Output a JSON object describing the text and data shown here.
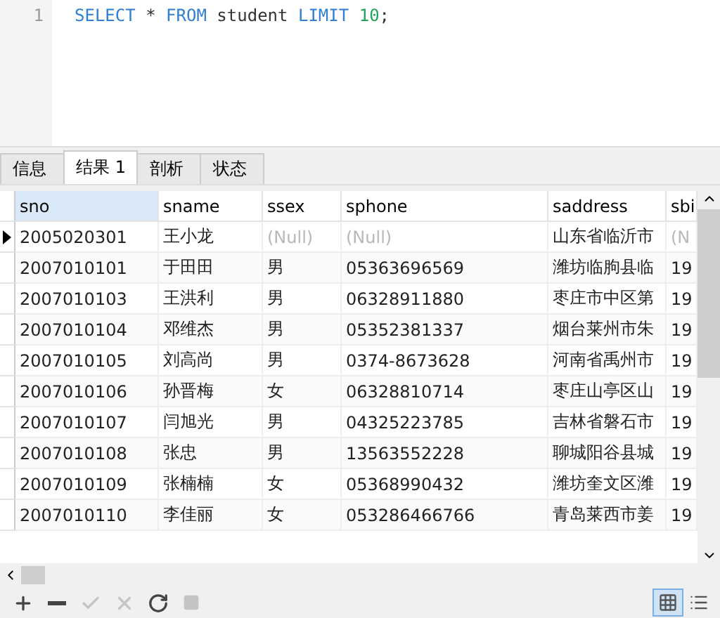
{
  "editor": {
    "lines": [
      {
        "number": "1",
        "tokens": [
          {
            "kind": "keyword",
            "text": "SELECT"
          },
          {
            "kind": "plain",
            "text": " * "
          },
          {
            "kind": "keyword",
            "text": "FROM"
          },
          {
            "kind": "plain",
            "text": " student "
          },
          {
            "kind": "keyword",
            "text": "LIMIT "
          },
          {
            "kind": "number",
            "text": "10"
          },
          {
            "kind": "plain",
            "text": ";"
          }
        ]
      }
    ]
  },
  "tabs": [
    {
      "label": "信息",
      "selected": false
    },
    {
      "label": "结果 1",
      "selected": true
    },
    {
      "label": "剖析",
      "selected": false
    },
    {
      "label": "状态",
      "selected": false
    }
  ],
  "table": {
    "columns": [
      "sno",
      "sname",
      "ssex",
      "sphone",
      "saddress",
      "sbi"
    ],
    "rows": [
      {
        "current": true,
        "cells": [
          "2005020301",
          "王小龙",
          {
            "text": "(Null)",
            "null": true
          },
          {
            "text": "(Null)",
            "null": true
          },
          "山东省临沂市",
          {
            "text": "(N",
            "null": true
          }
        ]
      },
      {
        "current": false,
        "cells": [
          "2007010101",
          "于田田",
          "男",
          "05363696569",
          "潍坊临朐县临",
          "19"
        ]
      },
      {
        "current": false,
        "cells": [
          "2007010103",
          "王洪利",
          "男",
          "06328911880",
          "枣庄市中区第",
          "19"
        ]
      },
      {
        "current": false,
        "cells": [
          "2007010104",
          "邓维杰",
          "男",
          "05352381337",
          "烟台莱州市朱",
          "19"
        ]
      },
      {
        "current": false,
        "cells": [
          "2007010105",
          "刘高尚",
          "男",
          "0374-8673628",
          "河南省禹州市",
          "19"
        ]
      },
      {
        "current": false,
        "cells": [
          "2007010106",
          "孙晋梅",
          "女",
          "06328810714",
          "枣庄山亭区山",
          "19"
        ]
      },
      {
        "current": false,
        "cells": [
          "2007010107",
          "闫旭光",
          "男",
          "04325223785",
          "吉林省磐石市",
          "19"
        ]
      },
      {
        "current": false,
        "cells": [
          "2007010108",
          "张忠",
          "男",
          "13563552228",
          "聊城阳谷县城",
          "19"
        ]
      },
      {
        "current": false,
        "cells": [
          "2007010109",
          "张楠楠",
          "女",
          "05368990432",
          "潍坊奎文区潍",
          "19"
        ]
      },
      {
        "current": false,
        "cells": [
          "2007010110",
          "李佳丽",
          "女",
          "053286466766",
          "青岛莱西市姜",
          "19"
        ]
      }
    ]
  },
  "toolbar": {
    "buttons": [
      {
        "kind": "add",
        "disabled": false
      },
      {
        "kind": "remove",
        "disabled": false
      },
      {
        "kind": "apply",
        "disabled": true
      },
      {
        "kind": "discard",
        "disabled": true
      },
      {
        "kind": "refresh",
        "disabled": false
      },
      {
        "kind": "stop",
        "disabled": true
      }
    ],
    "views": [
      {
        "kind": "grid",
        "selected": true
      },
      {
        "kind": "form",
        "selected": false
      }
    ]
  }
}
